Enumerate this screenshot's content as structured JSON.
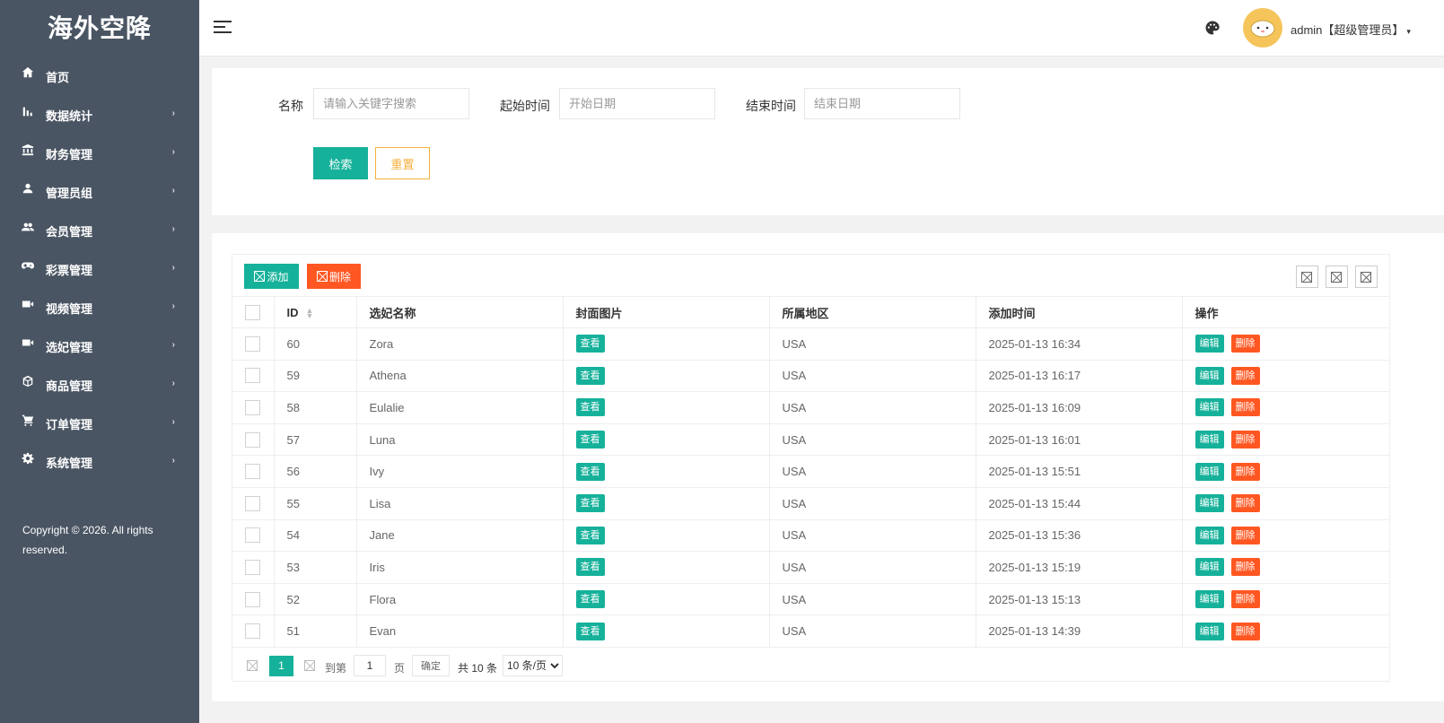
{
  "brand": {
    "title": "海外空降"
  },
  "sidebar": {
    "items": [
      {
        "label": "首页",
        "icon": "home-icon",
        "has_arrow": false
      },
      {
        "label": "数据统计",
        "icon": "bar-chart-icon",
        "has_arrow": true
      },
      {
        "label": "财务管理",
        "icon": "bank-icon",
        "has_arrow": true
      },
      {
        "label": "管理员组",
        "icon": "user-icon",
        "has_arrow": true
      },
      {
        "label": "会员管理",
        "icon": "users-icon",
        "has_arrow": true
      },
      {
        "label": "彩票管理",
        "icon": "gamepad-icon",
        "has_arrow": true
      },
      {
        "label": "视频管理",
        "icon": "video-icon",
        "has_arrow": true
      },
      {
        "label": "选妃管理",
        "icon": "video-icon",
        "has_arrow": true
      },
      {
        "label": "商品管理",
        "icon": "cube-icon",
        "has_arrow": true
      },
      {
        "label": "订单管理",
        "icon": "cart-icon",
        "has_arrow": true
      },
      {
        "label": "系统管理",
        "icon": "gear-icon",
        "has_arrow": true
      }
    ],
    "arrow": "›",
    "copyright": "Copyright © 2026. All rights reserved."
  },
  "header": {
    "user_label": "admin【超级管理员】",
    "caret": "▾"
  },
  "search": {
    "name_label": "名称",
    "name_placeholder": "请输入关键字搜索",
    "start_label": "起始时间",
    "start_placeholder": "开始日期",
    "end_label": "结束时间",
    "end_placeholder": "结束日期",
    "search_button": "检索",
    "reset_button": "重置"
  },
  "toolbar": {
    "add_label": "添加",
    "delete_label": "删除"
  },
  "table": {
    "columns": [
      "ID",
      "选妃名称",
      "封面图片",
      "所属地区",
      "添加时间",
      "操作"
    ],
    "view_label": "查看",
    "edit_label": "编辑",
    "delete_label": "删除",
    "rows": [
      {
        "id": "60",
        "name": "Zora",
        "region": "USA",
        "time": "2025-01-13 16:34"
      },
      {
        "id": "59",
        "name": "Athena",
        "region": "USA",
        "time": "2025-01-13 16:17"
      },
      {
        "id": "58",
        "name": "Eulalie",
        "region": "USA",
        "time": "2025-01-13 16:09"
      },
      {
        "id": "57",
        "name": "Luna",
        "region": "USA",
        "time": "2025-01-13 16:01"
      },
      {
        "id": "56",
        "name": "Ivy",
        "region": "USA",
        "time": "2025-01-13 15:51"
      },
      {
        "id": "55",
        "name": "Lisa",
        "region": "USA",
        "time": "2025-01-13 15:44"
      },
      {
        "id": "54",
        "name": "Jane",
        "region": "USA",
        "time": "2025-01-13 15:36"
      },
      {
        "id": "53",
        "name": "Iris",
        "region": "USA",
        "time": "2025-01-13 15:19"
      },
      {
        "id": "52",
        "name": "Flora",
        "region": "USA",
        "time": "2025-01-13 15:13"
      },
      {
        "id": "51",
        "name": "Evan",
        "region": "USA",
        "time": "2025-01-13 14:39"
      }
    ]
  },
  "pager": {
    "current_page": "1",
    "goto_label": "到第",
    "goto_value": "1",
    "page_suffix": "页",
    "confirm_label": "确定",
    "total_label": "共 10 条",
    "page_size_option": "10 条/页"
  },
  "colors": {
    "sidebar_bg": "#4a5563",
    "primary": "#16b19a",
    "danger": "#ff5722",
    "warning": "#f5b03d"
  }
}
